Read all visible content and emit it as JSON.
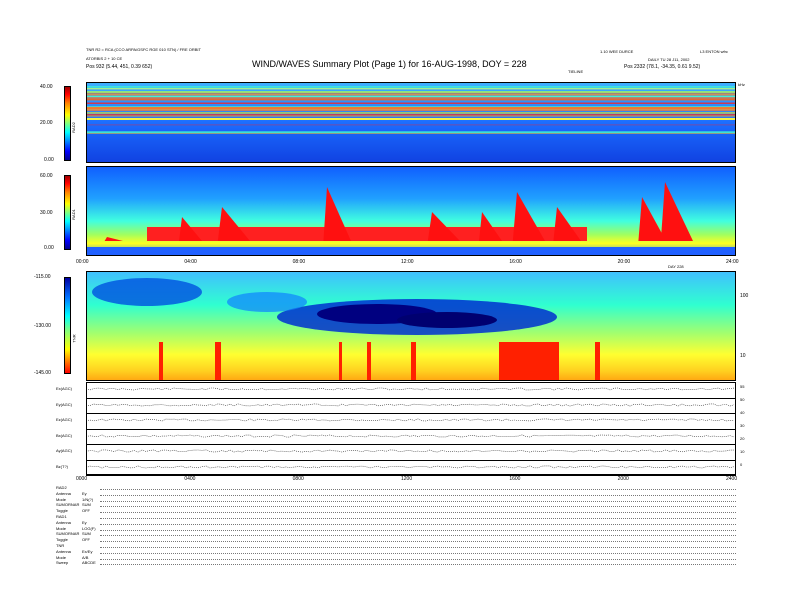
{
  "header": {
    "title": "WIND/WAVES Summary Plot (Page 1) for 16-AUG-1998, DOY = 228",
    "left_line1": "TNR R2 = RCA (CCO ARPA/GSFC RGE 010 STN) / FRE ORBIT",
    "left_line2": "ATORBIS 2 + 10 CE",
    "left_line3": "Pos    932 (5.44, 451, 0.39 652)",
    "center_sub": "TIELINE",
    "right_top1": "1.10 WEE DURCE",
    "right_top2": "L3 ENTON wfrc",
    "right_line2": "DAILY TU 28 J11, 2002",
    "right_line3": "Pos    2332 (78.1, -34.35, 0.61 9.52)",
    "right_marker": "kHz"
  },
  "chart_data": [
    {
      "type": "heatmap",
      "name": "RAD2",
      "ylabel": "RAD2",
      "yticks": [
        "40.00",
        "20.00",
        "0.00"
      ],
      "ylim": [
        0,
        40
      ]
    },
    {
      "type": "heatmap",
      "name": "RAD1",
      "ylabel": "RAD1",
      "yticks": [
        "60.00",
        "30.00",
        "0.00"
      ],
      "ylim": [
        0,
        60
      ],
      "xticks": [
        "00:00",
        "04:00",
        "08:00",
        "12:00",
        "16:00",
        "20:00",
        "24:00"
      ],
      "xtick_values": [
        0,
        4,
        8,
        12,
        16,
        20,
        24
      ],
      "xunit": "DAY 228"
    },
    {
      "type": "heatmap",
      "name": "TNR",
      "ylabel": "TNR",
      "yticks": [
        "-115.00",
        "-130.00",
        "-145.00"
      ],
      "ylim": [
        -145,
        -115
      ],
      "right_ticks": [
        "100",
        "10"
      ]
    },
    {
      "type": "line",
      "name": "housekeeping",
      "channels": [
        "Ex(AGC)",
        "Ey(AGC)",
        "Ez(AGC)",
        "Bx(AGC)",
        "Ay(AGC)",
        "Bz(T?)"
      ],
      "right_ticks": [
        "55",
        "50",
        "40",
        "30",
        "20",
        "10",
        "0"
      ],
      "xticks": [
        "0000",
        "0400",
        "0800",
        "1200",
        "1600",
        "2000",
        "2400"
      ],
      "xtick_values": [
        0,
        4,
        8,
        12,
        16,
        20,
        24
      ]
    }
  ],
  "footer": {
    "rows": [
      {
        "k": "RAD2",
        "v": ""
      },
      {
        "k": "Antenna",
        "v": "Ey"
      },
      {
        "k": "Mode",
        "v": "1/N(?)"
      },
      {
        "k": "SUMORNAR",
        "v": "SUM"
      },
      {
        "k": "Toggle",
        "v": "OFF"
      },
      {
        "k": "RAD1",
        "v": ""
      },
      {
        "k": "Antenna",
        "v": "Ey"
      },
      {
        "k": "Mode",
        "v": "LOG(F)"
      },
      {
        "k": "SUMORNAR",
        "v": "SUM"
      },
      {
        "k": "Toggle",
        "v": "OFF"
      },
      {
        "k": "TNR",
        "v": ""
      },
      {
        "k": "Antenna",
        "v": "Ex/Ey"
      },
      {
        "k": "Mode",
        "v": "A/B"
      },
      {
        "k": "Sweep",
        "v": "ABCDE"
      }
    ]
  }
}
